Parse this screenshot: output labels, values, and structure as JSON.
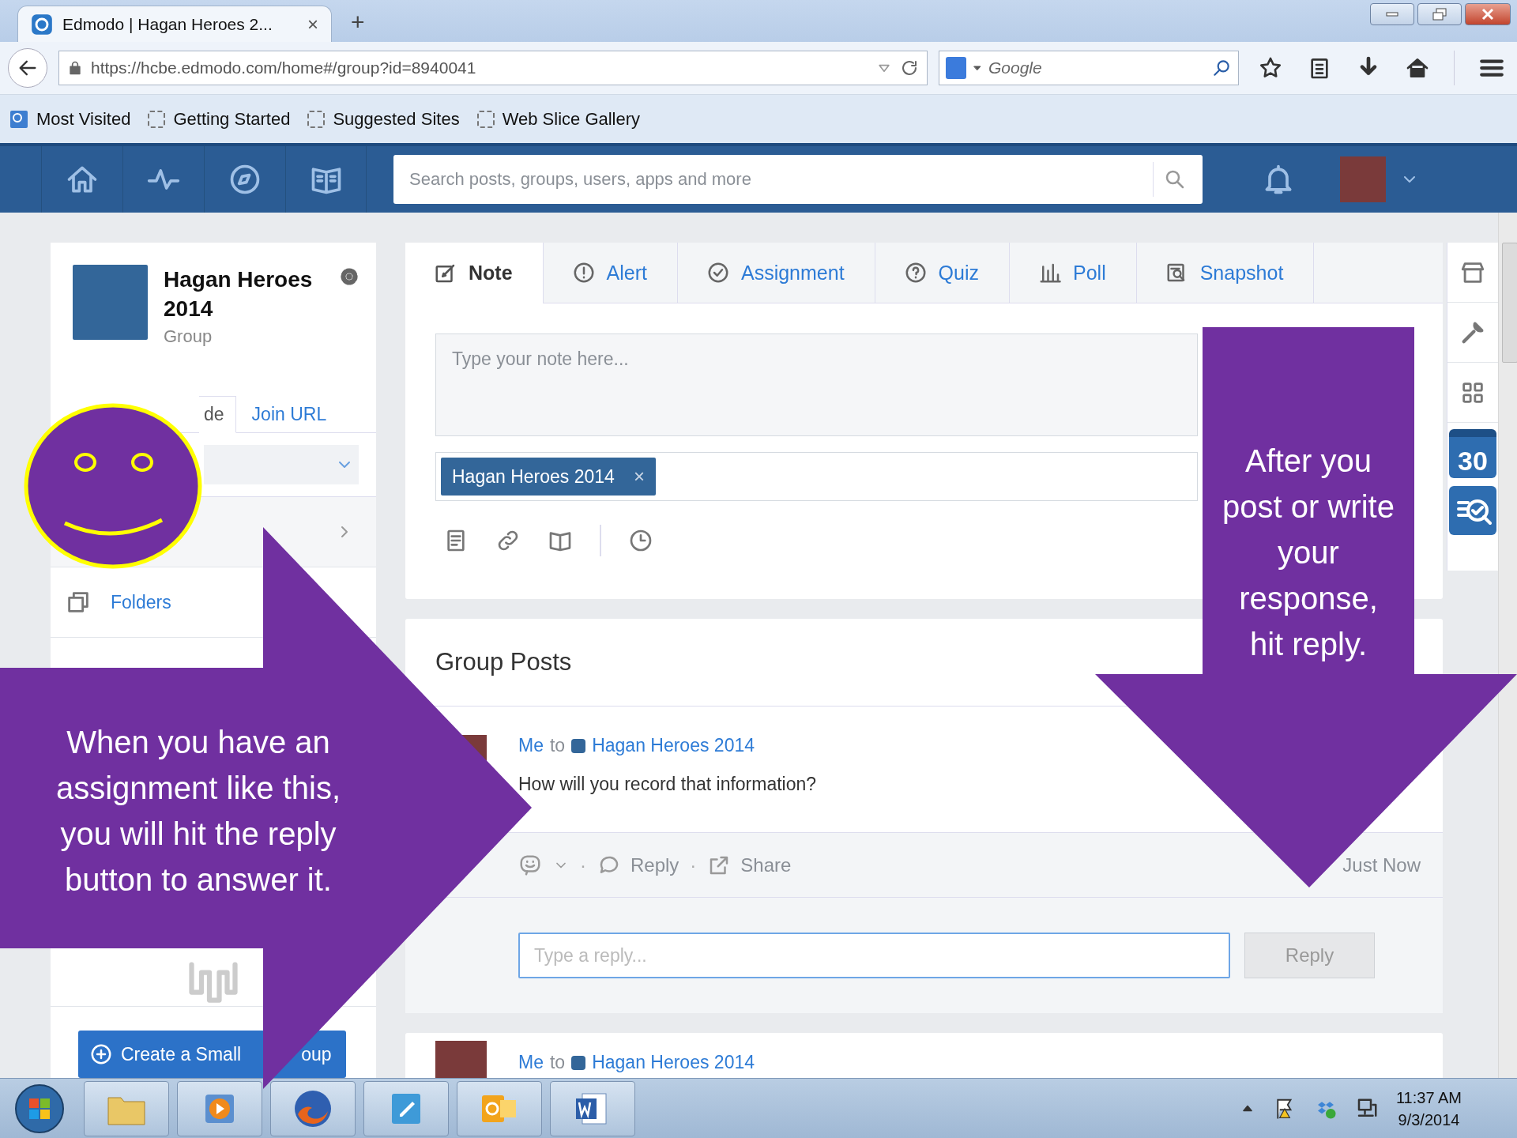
{
  "browser": {
    "tab_title": "Edmodo | Hagan Heroes 2...",
    "tab_close": "×",
    "new_tab": "+",
    "url": "https://hcbe.edmodo.com/home#/group?id=8940041",
    "search_placeholder": "Google",
    "bookmarks": [
      "Most Visited",
      "Getting Started",
      "Suggested Sites",
      "Web Slice Gallery"
    ]
  },
  "header": {
    "search_placeholder": "Search posts, groups, users, apps and more"
  },
  "group_card": {
    "name": "Hagan Heroes 2014",
    "type": "Group",
    "tabs": [
      {
        "label": "de",
        "selected": true
      },
      {
        "label": "Join URL",
        "selected": false
      }
    ],
    "folders": "Folders",
    "create_button": [
      "Create a Small",
      "oup"
    ]
  },
  "composer": {
    "tabs": [
      {
        "kind": "note",
        "label": "Note",
        "selected": true
      },
      {
        "kind": "alert",
        "label": "Alert",
        "selected": false
      },
      {
        "kind": "assignment",
        "label": "Assignment",
        "selected": false
      },
      {
        "kind": "quiz",
        "label": "Quiz",
        "selected": false
      },
      {
        "kind": "poll",
        "label": "Poll",
        "selected": false
      },
      {
        "kind": "snapshot",
        "label": "Snapshot",
        "selected": false
      }
    ],
    "placeholder": "Type your note here...",
    "recipient": "Hagan Heroes 2014",
    "remove": "×"
  },
  "posts_title": "Group Posts",
  "posts": [
    {
      "sender": "Me",
      "to": "to",
      "group": "Hagan Heroes 2014",
      "text": "How will you record that information?",
      "separator": "·",
      "reply": "Reply",
      "share": "Share",
      "time": "Just Now",
      "reply_placeholder": "Type a reply...",
      "reply_button": "Reply"
    },
    {
      "sender": "Me",
      "to": "to",
      "group": "Hagan Heroes 2014"
    }
  ],
  "right_rail": {
    "calendar_day": "30"
  },
  "callouts": [
    {
      "kind": "left",
      "text": "When you have an assignment like this, you will hit the reply button to answer it."
    },
    {
      "kind": "down",
      "text": "After you post or write your response, hit reply."
    }
  ],
  "taskbar": {
    "time": "11:37 AM",
    "date": "9/3/2014"
  }
}
